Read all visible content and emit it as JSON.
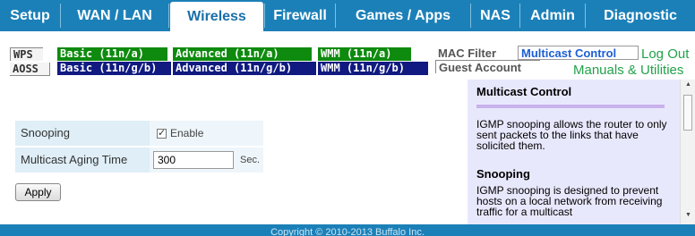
{
  "nav": {
    "tabs": [
      "Setup",
      "WAN / LAN",
      "Wireless",
      "Firewall",
      "Games / Apps",
      "NAS",
      "Admin",
      "Diagnostic"
    ],
    "active": "Wireless"
  },
  "submenu": {
    "wps": "WPS",
    "aoss": "AOSS",
    "basic_a": "Basic (11n/a)",
    "basic_g": "Basic (11n/g/b)",
    "adv_a": "Advanced (11n/a)",
    "adv_g": "Advanced (11n/g/b)",
    "wmm_a": "WMM (11n/a)",
    "wmm_g": "WMM (11n/g/b)",
    "mac_filter": "MAC Filter",
    "multicast": "Multicast Control",
    "guest": "Guest Account"
  },
  "links": {
    "logout": "Log Out",
    "manuals": "Manuals & Utilities"
  },
  "form": {
    "snooping_label": "Snooping",
    "snooping_checked": true,
    "enable_label": "Enable",
    "aging_label": "Multicast Aging Time",
    "aging_value": "300",
    "aging_unit": "Sec.",
    "apply": "Apply"
  },
  "help": {
    "title": "Multicast Control",
    "intro": "IGMP snooping allows the router to only sent packets to the links that have solicited them.",
    "snooping_title": "Snooping",
    "snooping_text": "IGMP snooping is designed to prevent hosts on a local network from receiving traffic for a multicast"
  },
  "footer": {
    "copyright": "Copyright © 2010-2013 Buffalo Inc."
  },
  "colors": {
    "nav_blue": "#1c80b8",
    "green": "#0e8a0e",
    "navy": "#101a80",
    "help_bg": "#e8e8fd"
  }
}
